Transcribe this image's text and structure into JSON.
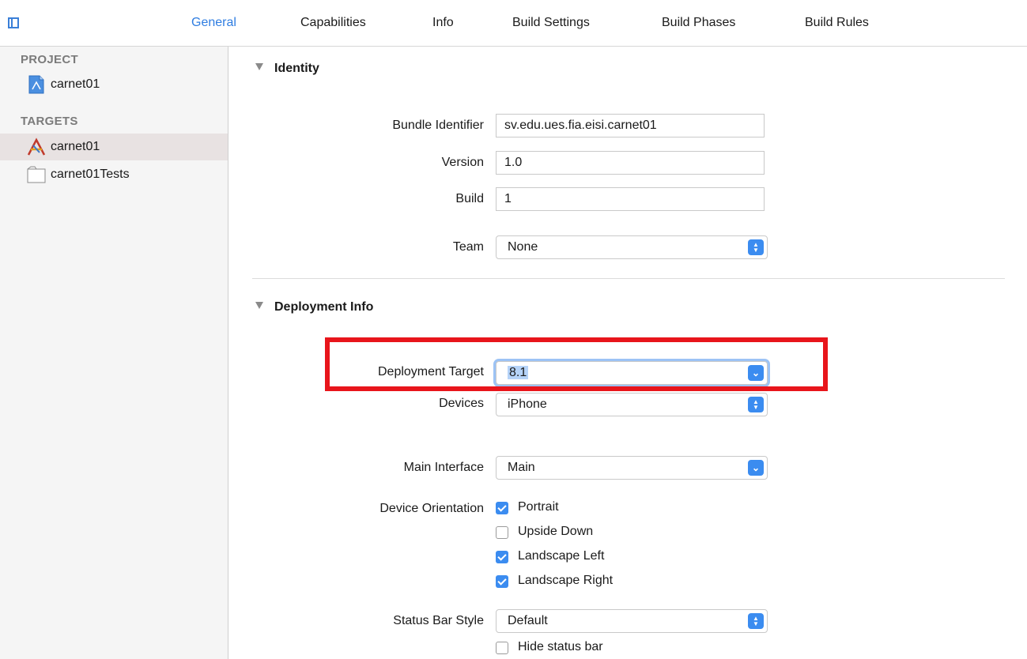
{
  "tabs": [
    "General",
    "Capabilities",
    "Info",
    "Build Settings",
    "Build Phases",
    "Build Rules"
  ],
  "active_tab": "General",
  "sidebar": {
    "project_header": "PROJECT",
    "project_items": [
      {
        "label": "carnet01",
        "icon": "project-file-icon"
      }
    ],
    "targets_header": "TARGETS",
    "target_items": [
      {
        "label": "carnet01",
        "icon": "app-target-icon",
        "selected": true
      },
      {
        "label": "carnet01Tests",
        "icon": "test-bundle-icon",
        "selected": false
      }
    ]
  },
  "identity": {
    "title": "Identity",
    "bundle_identifier_label": "Bundle Identifier",
    "bundle_identifier_value": "sv.edu.ues.fia.eisi.carnet01",
    "version_label": "Version",
    "version_value": "1.0",
    "build_label": "Build",
    "build_value": "1",
    "team_label": "Team",
    "team_value": "None"
  },
  "deployment": {
    "title": "Deployment Info",
    "deployment_target_label": "Deployment Target",
    "deployment_target_value": "8.1",
    "devices_label": "Devices",
    "devices_value": "iPhone",
    "main_interface_label": "Main Interface",
    "main_interface_value": "Main",
    "device_orientation_label": "Device Orientation",
    "orientations": [
      {
        "label": "Portrait",
        "checked": true
      },
      {
        "label": "Upside Down",
        "checked": false
      },
      {
        "label": "Landscape Left",
        "checked": true
      },
      {
        "label": "Landscape Right",
        "checked": true
      }
    ],
    "status_bar_style_label": "Status Bar Style",
    "status_bar_style_value": "Default",
    "hide_status_bar_label": "Hide status bar",
    "hide_status_bar_checked": false
  },
  "colors": {
    "accent": "#3b8cf0",
    "highlight_box": "#e8151b",
    "active_tab": "#2f7de1"
  }
}
